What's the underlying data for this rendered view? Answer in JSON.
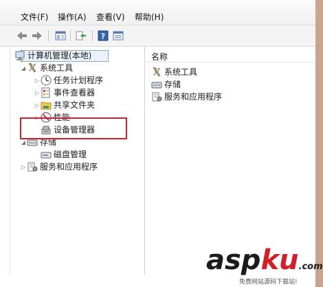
{
  "menu": {
    "items": [
      {
        "label": "文件(F)"
      },
      {
        "label": "操作(A)"
      },
      {
        "label": "查看(V)"
      },
      {
        "label": "帮助(H)"
      }
    ]
  },
  "toolbar": {
    "buttons": [
      "back-icon",
      "forward-icon",
      "show-hide-tree-icon",
      "export-list-icon",
      "help-icon",
      "properties-icon"
    ]
  },
  "tree": {
    "root": "计算机管理(本地)",
    "system_tools": "系统工具",
    "task_scheduler": "任务计划程序",
    "event_viewer": "事件查看器",
    "shared_folders": "共享文件夹",
    "performance": "性能",
    "device_manager": "设备管理器",
    "storage": "存储",
    "disk_management": "磁盘管理",
    "services_apps": "服务和应用程序"
  },
  "list": {
    "column_name": "名称",
    "items": [
      "系统工具",
      "存储",
      "服务和应用程序"
    ]
  },
  "watermark": {
    "logo_a": "asp",
    "logo_b": "ku",
    "logo_c": ".com",
    "sub": "免费网站源码下载站!"
  },
  "colors": {
    "highlight_border": "#d0202a",
    "watermark_dark": "#1b1b1b",
    "watermark_red": "#d21f2a"
  }
}
